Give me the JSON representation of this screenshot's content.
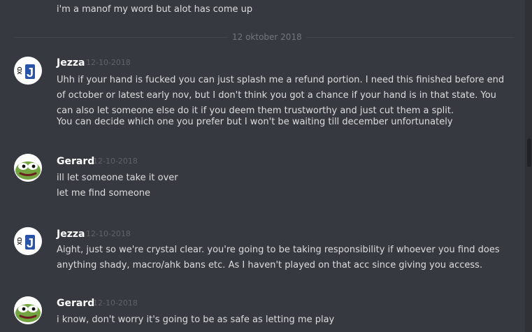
{
  "top_line": "i'm a manof my word but alot has come up",
  "date_divider": "12 oktober 2018",
  "messages": [
    {
      "author": "Jezza",
      "timestamp": "12-10-2018",
      "avatar_text": "J",
      "avatar_small_text": "XD",
      "lines": [
        "Uhh if your hand is fucked you can just splash me a refund portion. I need this finished before end of october or latest early nov, but I don't think you got a chance if your hand is in that state. You can also let someone else do it if you deem them trustworthy and just cut them a split.",
        "You can decide which one you prefer but I won't be waiting till december unfortunately"
      ]
    },
    {
      "author": "Gerard",
      "timestamp": "12-10-2018",
      "lines": [
        "ill let someone take it over",
        "let me find someone"
      ]
    },
    {
      "author": "Jezza",
      "timestamp": "12-10-2018",
      "avatar_text": "J",
      "avatar_small_text": "XD",
      "lines": [
        "Aight, just so we're crystal clear. you're going to be taking responsibility if whoever you find does anything shady, macro/ahk bans etc. As I haven't played on that acc since giving you access."
      ]
    },
    {
      "author": "Gerard",
      "timestamp": "12-10-2018",
      "lines": [
        "i know, don't worry it's going to be as safe as letting me play"
      ]
    }
  ],
  "colors": {
    "background": "#36393f",
    "text": "#dcddde",
    "author": "#ffffff",
    "timestamp": "#5f6368",
    "divider_text": "#72767d",
    "avatar_blue": "#2a54a8",
    "pepe_green": "#72a542"
  }
}
